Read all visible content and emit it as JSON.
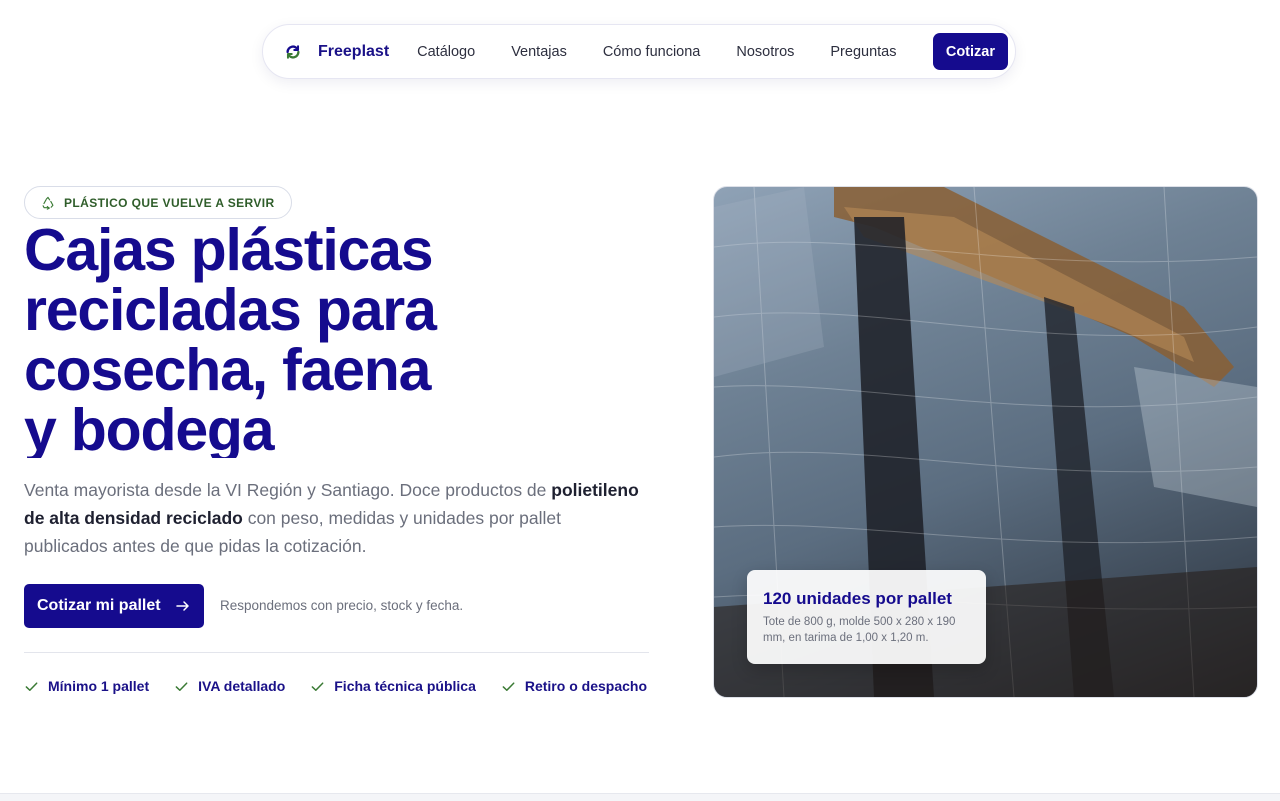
{
  "nav": {
    "brand": "Freeplast",
    "links": [
      "Catálogo",
      "Ventajas",
      "Cómo funciona",
      "Nosotros",
      "Preguntas"
    ],
    "cta": "Cotizar"
  },
  "hero": {
    "eyebrow": "PLÁSTICO QUE VUELVE A SERVIR",
    "headline_lines": [
      "Cajas plásticas",
      "recicladas para",
      "cosecha, faena",
      "y bodega"
    ],
    "lead_before": "Venta mayorista desde la VI Región y Santiago. Doce productos de ",
    "lead_bold": "polietileno de alta densidad reciclado",
    "lead_after": " con peso, medidas y unidades por pallet publicados antes de que pidas la cotización.",
    "primary_button": "Cotizar mi pallet",
    "cta_note": "Respondemos con precio, stock y fecha.",
    "features": [
      "Mínimo 1 pallet",
      "IVA detallado",
      "Ficha técnica pública",
      "Retiro o despacho"
    ]
  },
  "photo_card": {
    "title": "120 unidades por pallet",
    "detail": "Tote de 800 g, molde 500 x 280 x 190 mm, en tarima de 1,00 x 1,20 m."
  },
  "icons": {
    "logo": "refresh-loop-icon",
    "eyebrow": "recycle-icon",
    "button": "arrow-right-icon",
    "feature": "check-icon"
  },
  "colors": {
    "primary": "#150b8e",
    "eyebrow_text": "#2f5d2a",
    "check": "#3a7a34",
    "muted_text": "#6b6f7c"
  }
}
